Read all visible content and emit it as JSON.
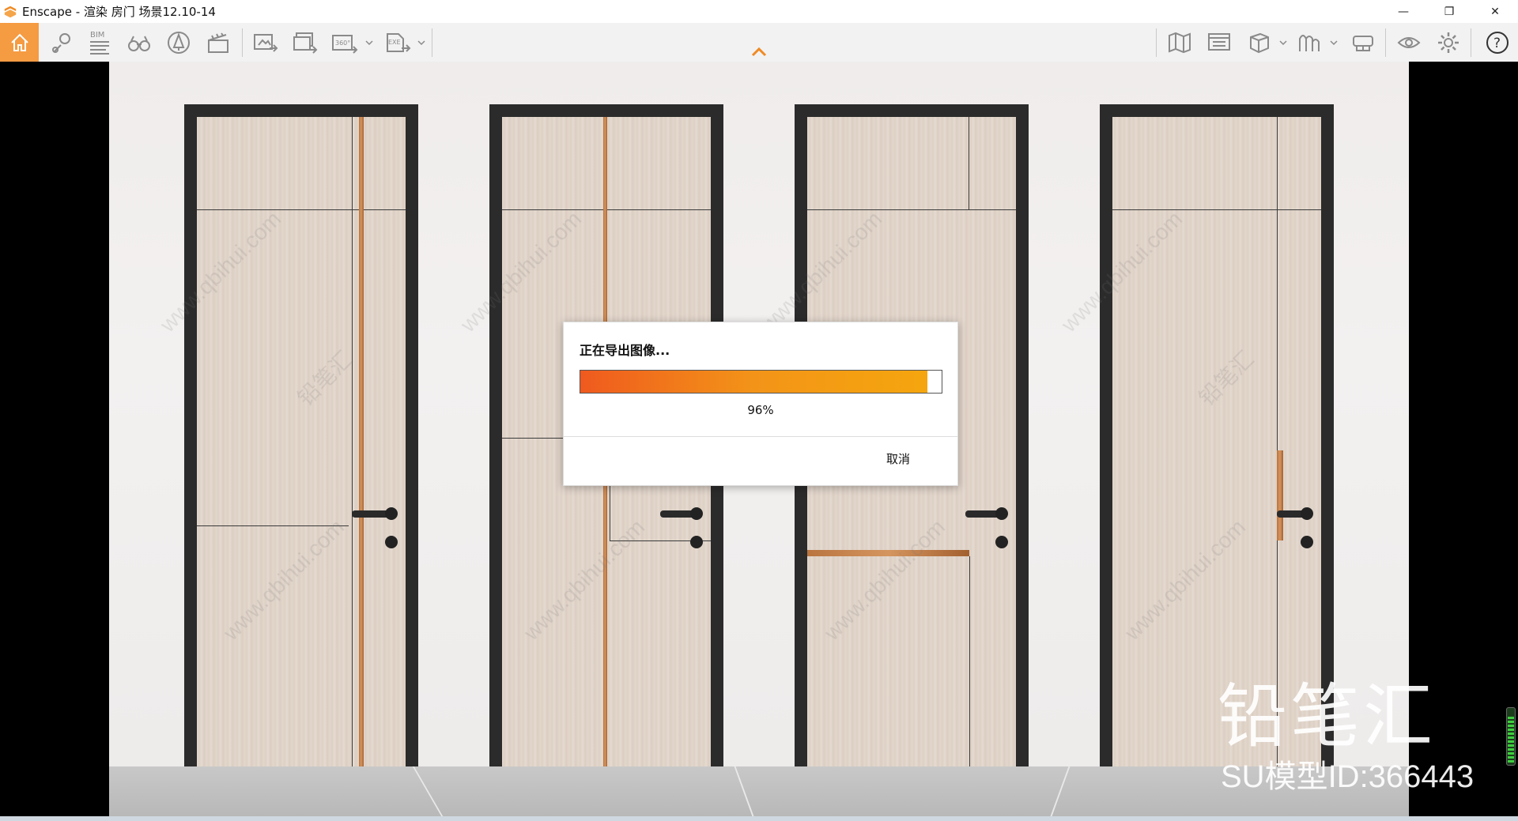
{
  "window": {
    "title": "Enscape - 渲染 房门 场景12.10-14",
    "controls": {
      "minimize": "—",
      "maximize": "❐",
      "close": "✕"
    }
  },
  "toolbar": {
    "left_icons": [
      "home-icon",
      "location-pin-icon",
      "bim-icon",
      "binoculars-icon",
      "atmosphere-icon",
      "clapperboard-icon",
      "screenshot-export-icon",
      "batch-render-icon",
      "panorama-360-icon",
      "exe-export-icon"
    ],
    "bim_label": "BIM",
    "panorama_label": "360°",
    "exe_label": "EXE",
    "right_icons": [
      "map-icon",
      "views-icon",
      "cube-icon",
      "asset-library-icon",
      "vr-headset-icon",
      "eye-icon",
      "settings-gear-icon",
      "help-icon"
    ],
    "help_label": "?"
  },
  "dialog": {
    "title": "正在导出图像...",
    "progress": 0.96,
    "progress_text": "96%",
    "cancel_label": "取消"
  },
  "watermark": {
    "brand": "铅笔汇",
    "model_id": "SU模型ID:366443",
    "tile_text": "www.qbihui.com",
    "tile_brand": "铅笔汇"
  },
  "colors": {
    "accent_orange": "#f59b42",
    "progress_start": "#ef5a1e",
    "progress_end": "#f5a60e",
    "door_frame": "#2b2b2b",
    "copper_inlay": "#c98650"
  }
}
